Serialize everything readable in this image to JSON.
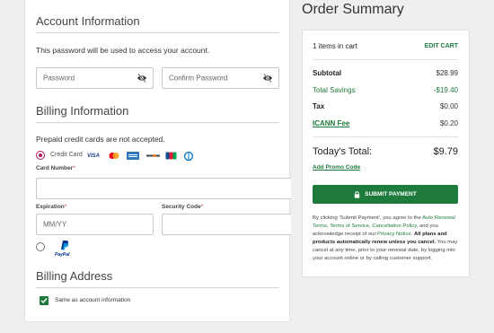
{
  "account": {
    "title": "Account Information",
    "note": "This password will be used to access your account.",
    "password_placeholder": "Password",
    "confirm_placeholder": "Confirm Password"
  },
  "billing": {
    "title": "Billing Information",
    "note": "Prepaid credit cards are not accepted.",
    "credit_card_label": "Credit Card",
    "card_logos": [
      "VISA",
      "MASTERCARD",
      "AMEX",
      "DISCOVER",
      "JCB",
      "DINERS"
    ],
    "card_number_label": "Card Number",
    "expiration_label": "Expiration",
    "expiration_placeholder": "MM/YY",
    "security_label": "Security Code",
    "required_mark": "*",
    "paypal_label": "PayPal"
  },
  "address": {
    "title": "Billing Address",
    "same_label": "Same as account information"
  },
  "summary": {
    "title": "Order Summary",
    "items_in_cart": "1 items in cart",
    "edit_cart": "EDIT CART",
    "subtotal_label": "Subtotal",
    "subtotal_value": "$28.99",
    "savings_label": "Total Savings",
    "savings_value": "-$19.40",
    "tax_label": "Tax",
    "tax_value": "$0.00",
    "icann_label": "ICANN Fee",
    "icann_value": "$0.20",
    "total_label": "Today's Total:",
    "total_value": "$9.79",
    "promo_link": "Add Promo Code",
    "submit_label": "SUBMIT PAYMENT",
    "terms": {
      "t1": "By clicking 'Submit Payment', you agree to the ",
      "link_auto": "Auto Renewal Terms",
      "t2": ", ",
      "link_tos": "Terms of Service",
      "t3": ", ",
      "link_cancel": "Cancellation Policy",
      "t4": ", and you acknowledge receipt of our ",
      "link_privacy": "Privacy Notice",
      "t5": ". ",
      "bold": "All plans and products automatically renew unless you cancel.",
      "t6": " You may cancel at any time, prior to your renewal date, by logging into your account online or by calling customer support."
    }
  },
  "colors": {
    "accent_green": "#1e7b3c",
    "radio_active": "#a3195b",
    "background": "#efefef"
  }
}
